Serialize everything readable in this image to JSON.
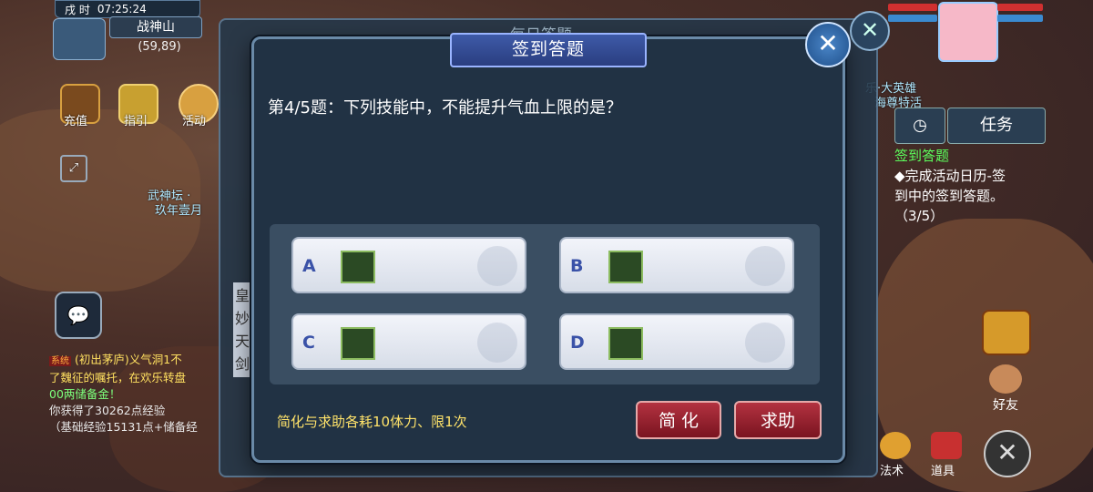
{
  "hud": {
    "time_prefix": "戌 时",
    "time": "07:25:24",
    "map_name": "战神山",
    "coords": "(59,89)",
    "shortcuts": [
      {
        "label": "充值"
      },
      {
        "label": "指引"
      },
      {
        "label": "活动"
      }
    ],
    "map_text_1": "武神坛 ·",
    "map_text_2": "玖年壹月"
  },
  "chat": {
    "lines": [
      {
        "tag": "系统",
        "text": "(初出茅庐)义气洞1不"
      },
      {
        "text": "了魏征的嘱托，在欢乐转盘"
      },
      {
        "text": "00两储备金！"
      },
      {
        "text": "你获得了30262点经验"
      },
      {
        "text": "（基础经验15131点+储备经"
      }
    ]
  },
  "right_hud": {
    "task_button": "任务",
    "task_title": "签到答题",
    "task_desc_1": "◆完成活动日历-签",
    "task_desc_2": "到中的签到答题。",
    "task_progress": "（3/5）",
    "friend_label": "好友",
    "spell_label": "法术",
    "item_label": "道具",
    "player_name_1": "乐·大英雄",
    "player_name_2": "海尊特活"
  },
  "background_dialog": {
    "title": "每日答题",
    "side_text": [
      "皇",
      "妙",
      "天",
      "剑"
    ]
  },
  "dialog": {
    "title": "签到答题",
    "question": "第4/5题：下列技能中，不能提升气血上限的是？",
    "answers": [
      {
        "letter": "A",
        "icon": "gourd-skill-icon"
      },
      {
        "letter": "B",
        "icon": "herb-skill-icon"
      },
      {
        "letter": "C",
        "icon": "figures-skill-icon"
      },
      {
        "letter": "D",
        "icon": "gate-skill-icon"
      }
    ],
    "note": "简化与求助各耗10体力、限1次",
    "simplify_button": "简 化",
    "help_button": "求助",
    "close_icon": "close-icon"
  },
  "colors": {
    "dialog_bg": "#213244",
    "title_blue": "#3e5aa8",
    "note_yellow": "#ffe36a",
    "button_red": "#b33240",
    "task_green": "#5cff5c"
  }
}
